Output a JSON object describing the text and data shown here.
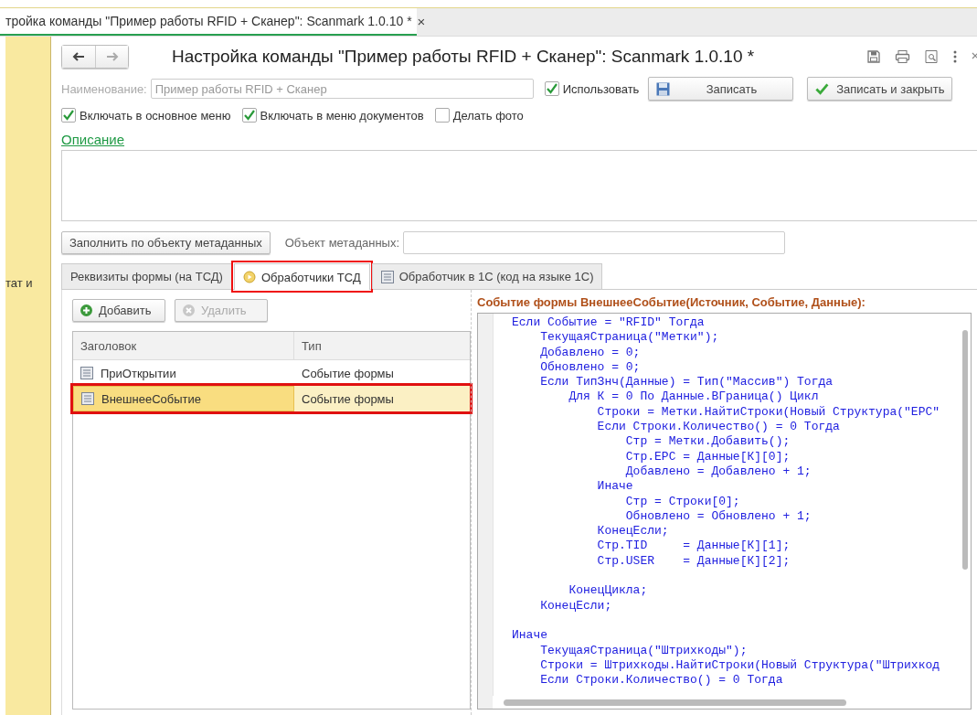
{
  "doc_tab": {
    "title": "тройка команды \"Пример работы RFID + Сканер\": Scanmark 1.0.10 *",
    "close": "×",
    "selected": true
  },
  "sidebar": {
    "text": "тат и"
  },
  "form": {
    "title": "Настройка команды \"Пример работы RFID + Сканер\": Scanmark 1.0.10 *",
    "name_label": "Наименование:",
    "name_value": "Пример работы RFID + Сканер",
    "use": {
      "label": "Использовать",
      "checked": true
    },
    "save_button": "Записать",
    "save_close_button": "Записать и закрыть",
    "options": [
      {
        "label": "Включать в основное меню",
        "checked": true
      },
      {
        "label": "Включать в меню документов",
        "checked": true
      },
      {
        "label": "Делать фото",
        "checked": false
      }
    ],
    "description_link": "Описание",
    "fill_button": "Заполнить по объекту метаданных",
    "metadata_label": "Объект метаданных:"
  },
  "tabs": [
    {
      "label": "Реквизиты формы (на ТСД)",
      "selected": false,
      "highlighted": false,
      "kind": "plain"
    },
    {
      "label": "Обработчики ТСД",
      "selected": true,
      "highlighted": true,
      "kind": "handler"
    },
    {
      "label": "Обработчик в 1С (код на языке 1С)",
      "selected": false,
      "highlighted": false,
      "kind": "module"
    }
  ],
  "toolbar": [
    {
      "label": "Добавить",
      "disabled": false,
      "kind": "add"
    },
    {
      "label": "Удалить",
      "disabled": true,
      "kind": "delete"
    }
  ],
  "table": {
    "columns": [
      "Заголовок",
      "Тип"
    ],
    "rows": [
      {
        "cells": [
          "ПриОткрытии",
          "Событие формы"
        ],
        "selected": false,
        "highlighted": false
      },
      {
        "cells": [
          "ВнешнееСобытие",
          "Событие формы"
        ],
        "selected": true,
        "highlighted": true
      }
    ]
  },
  "editor": {
    "title": "Событие формы ВнешнееСобытие(Источник, Событие, Данные):",
    "code": "Если Событие = \"RFID\" Тогда\n    ТекущаяСтраница(\"Метки\");\n    Добавлено = 0;\n    Обновлено = 0;\n    Если ТипЗнч(Данные) = Тип(\"Массив\") Тогда\n        Для К = 0 По Данные.ВГраница() Цикл\n            Строки = Метки.НайтиСтроки(Новый Структура(\"EPC\"\n            Если Строки.Количество() = 0 Тогда\n                Стр = Метки.Добавить();\n                Стр.EPC = Данные[К][0];\n                Добавлено = Добавлено + 1;\n            Иначе\n                Стр = Строки[0];\n                Обновлено = Обновлено + 1;\n            КонецЕсли;\n            Стр.TID     = Данные[К][1];\n            Стр.USER    = Данные[К][2];\n\n        КонецЦикла;\n    КонецЕсли;\n\nИначе\n    ТекущаяСтраница(\"Штрихкоды\");\n    Строки = Штрихкоды.НайтиСтроки(Новый Структура(\"Штрихкод\n    Если Строки.Количество() = 0 Тогда"
  }
}
